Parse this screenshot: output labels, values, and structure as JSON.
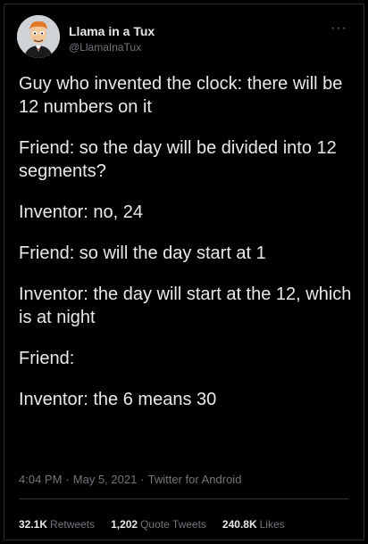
{
  "user": {
    "display_name": "Llama in a Tux",
    "handle": "@LlamaInaTux",
    "avatar_icon": "cartoon-avatar-icon"
  },
  "more_icon": "···",
  "tweet": {
    "paragraphs": [
      "Guy who invented the clock: there will be 12 numbers on it",
      "Friend: so the day will be divided into 12 segments?",
      "Inventor: no, 24",
      "Friend: so will the day start at 1",
      "Inventor: the day will start at the 12, which is at night",
      "Friend:",
      "Inventor: the 6 means 30"
    ]
  },
  "meta": {
    "time": "4:04 PM",
    "date": "May 5, 2021",
    "source": "Twitter for Android",
    "separator": "·"
  },
  "stats": {
    "retweets_count": "32.1K",
    "retweets_label": "Retweets",
    "quotes_count": "1,202",
    "quotes_label": "Quote Tweets",
    "likes_count": "240.8K",
    "likes_label": "Likes"
  },
  "colors": {
    "background": "#000000",
    "text": "#e7e9ea",
    "secondary": "#71767b",
    "divider": "#2f3336"
  }
}
